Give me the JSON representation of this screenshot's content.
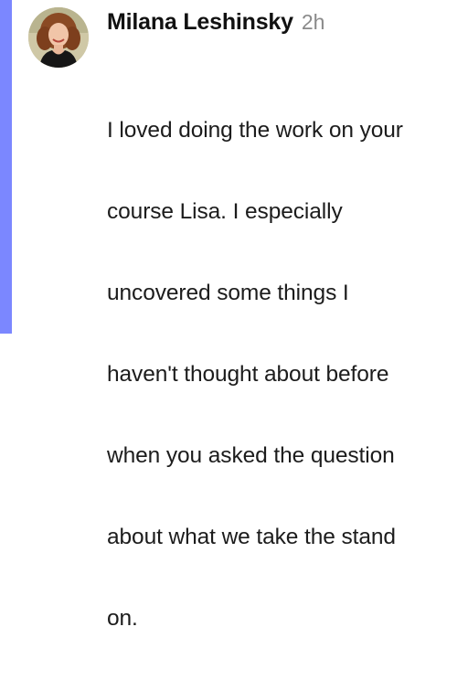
{
  "post": {
    "author": "Milana Leshinsky",
    "timestamp": "2h",
    "comment_lines": [
      "I loved doing the work on your",
      "course Lisa. I especially",
      "uncovered some things I",
      "haven't thought about before",
      "when you asked the question",
      "about what we take the stand",
      "on."
    ]
  },
  "colors": {
    "accent": "#7b87ff",
    "timestamp": "#8a8a8a"
  },
  "icons": {
    "avatar": "user-avatar-photo"
  }
}
